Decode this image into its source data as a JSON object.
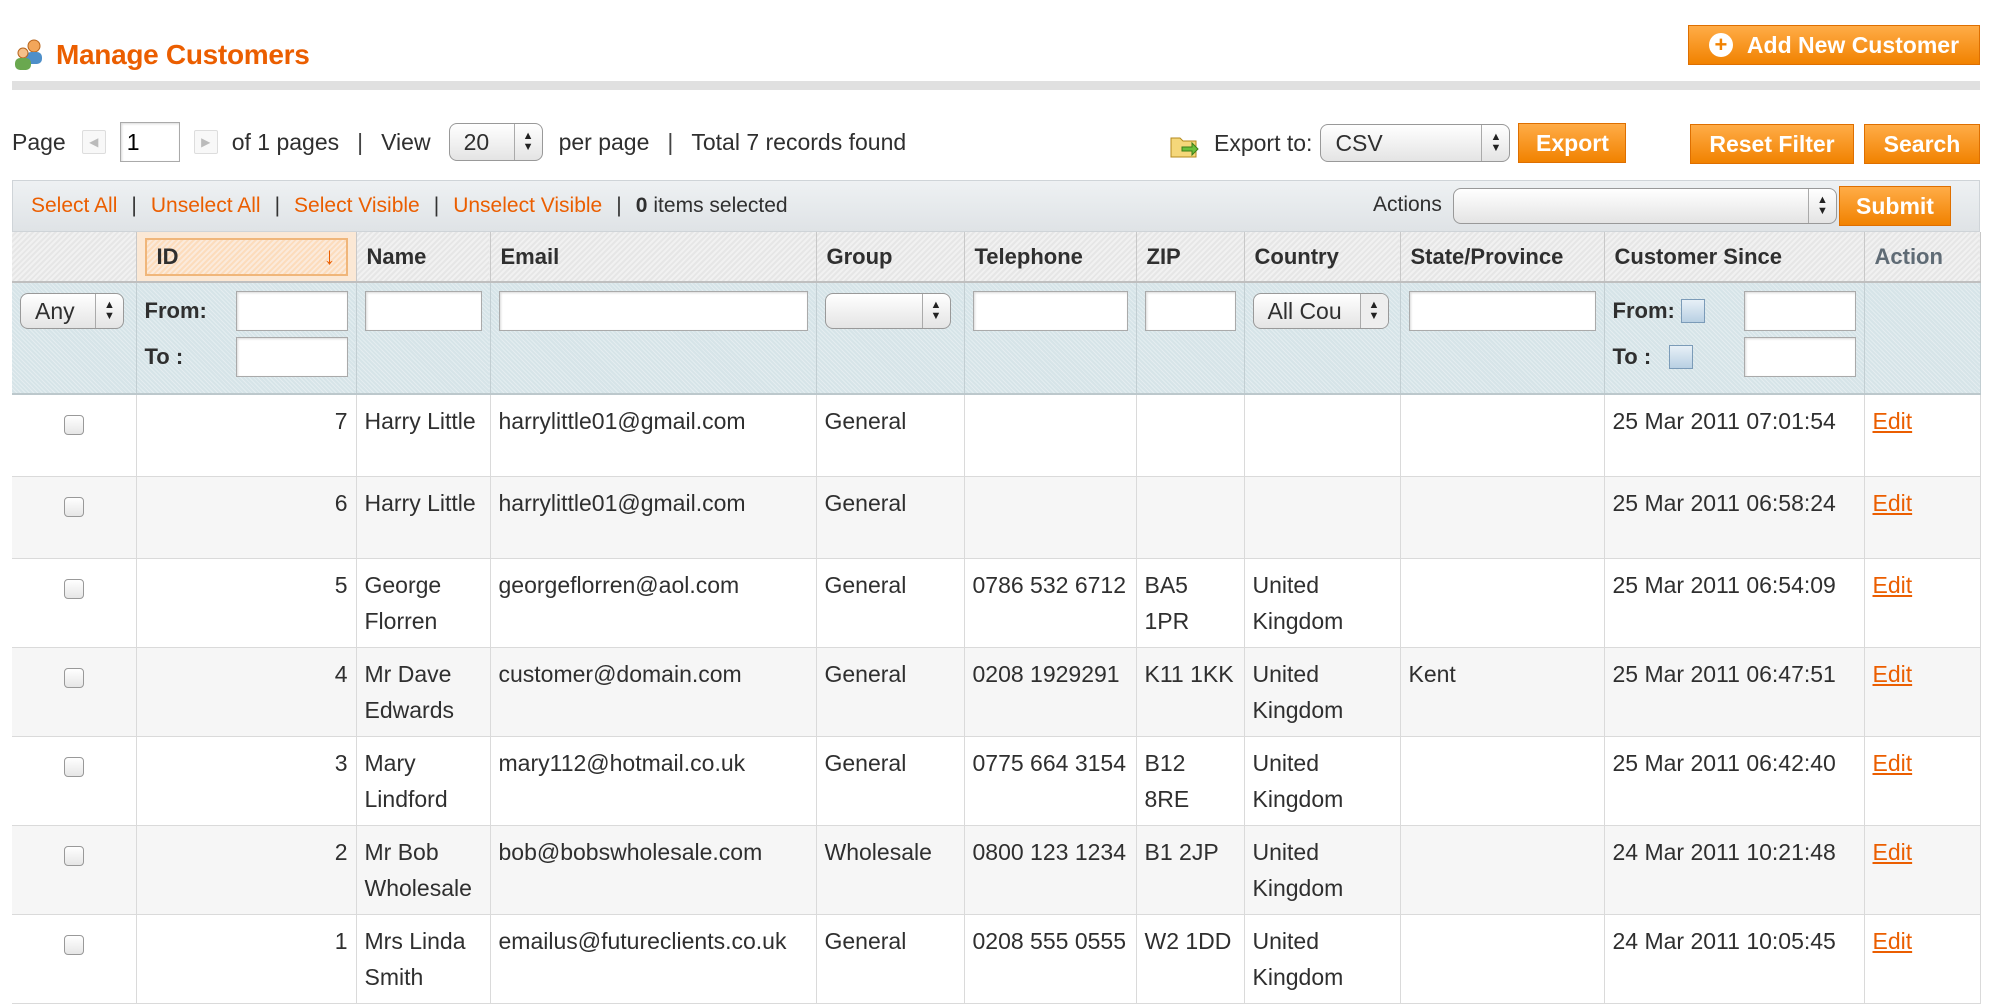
{
  "header": {
    "title": "Manage Customers",
    "add_button_label": "Add New Customer"
  },
  "pager": {
    "page_label": "Page",
    "current_page": "1",
    "of_pages": "of 1 pages",
    "view_label": "View",
    "per_page_value": "20",
    "per_page_label": "per page",
    "total_text": "Total 7 records found"
  },
  "export": {
    "label": "Export to:",
    "format": "CSV",
    "export_button": "Export"
  },
  "buttons": {
    "reset_filter": "Reset Filter",
    "search": "Search",
    "submit": "Submit"
  },
  "massaction": {
    "select_all": "Select All",
    "unselect_all": "Unselect All",
    "select_visible": "Select Visible",
    "unselect_visible": "Unselect Visible",
    "selected_count": "0",
    "selected_text": "items selected",
    "actions_label": "Actions",
    "actions_value": ""
  },
  "columns": [
    "ID",
    "Name",
    "Email",
    "Group",
    "Telephone",
    "ZIP",
    "Country",
    "State/Province",
    "Customer Since",
    "Action"
  ],
  "filters": {
    "any_option": "Any",
    "from_label": "From:",
    "to_label": "To :",
    "country_option": "All Cou",
    "since_from_label": "From:",
    "since_to_label": "To :"
  },
  "rows": [
    {
      "id": "7",
      "name": "Harry Little",
      "email": "harrylittle01@gmail.com",
      "group": "General",
      "telephone": "",
      "zip": "",
      "country": "",
      "state": "",
      "since": "25 Mar 2011 07:01:54",
      "action": "Edit"
    },
    {
      "id": "6",
      "name": "Harry Little",
      "email": "harrylittle01@gmail.com",
      "group": "General",
      "telephone": "",
      "zip": "",
      "country": "",
      "state": "",
      "since": "25 Mar 2011 06:58:24",
      "action": "Edit"
    },
    {
      "id": "5",
      "name": "George Florren",
      "email": "georgeflorren@aol.com",
      "group": "General",
      "telephone": "0786 532 6712",
      "zip": "BA5 1PR",
      "country": "United Kingdom",
      "state": "",
      "since": "25 Mar 2011 06:54:09",
      "action": "Edit"
    },
    {
      "id": "4",
      "name": "Mr Dave Edwards",
      "email": "customer@domain.com",
      "group": "General",
      "telephone": "0208 1929291",
      "zip": "K11 1KK",
      "country": "United Kingdom",
      "state": "Kent",
      "since": "25 Mar 2011 06:47:51",
      "action": "Edit"
    },
    {
      "id": "3",
      "name": "Mary Lindford",
      "email": "mary112@hotmail.co.uk",
      "group": "General",
      "telephone": "0775 664 3154",
      "zip": "B12 8RE",
      "country": "United Kingdom",
      "state": "",
      "since": "25 Mar 2011 06:42:40",
      "action": "Edit"
    },
    {
      "id": "2",
      "name": "Mr Bob Wholesale",
      "email": "bob@bobswholesale.com",
      "group": "Wholesale",
      "telephone": "0800 123 1234",
      "zip": "B1 2JP",
      "country": "United Kingdom",
      "state": "",
      "since": "24 Mar 2011 10:21:48",
      "action": "Edit"
    },
    {
      "id": "1",
      "name": "Mrs Linda Smith",
      "email": "emailus@futureclients.co.uk",
      "group": "General",
      "telephone": "0208 555 0555",
      "zip": "W2 1DD",
      "country": "United Kingdom",
      "state": "",
      "since": "24 Mar 2011 10:05:45",
      "action": "Edit"
    }
  ],
  "colors": {
    "accent": "#eb5e00",
    "button": "#f18200"
  },
  "icons": {
    "page": "customers-icon",
    "add": "plus-circle-icon",
    "export": "folder-export-icon",
    "calendar": "calendar-icon",
    "sort": "sort-down-arrow-icon"
  }
}
